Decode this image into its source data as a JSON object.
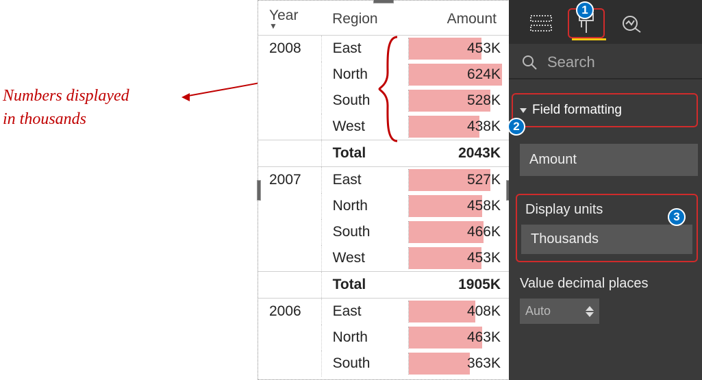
{
  "annotation": {
    "line1": "Numbers displayed",
    "line2": "in thousands"
  },
  "matrix": {
    "headers": {
      "year": "Year",
      "region": "Region",
      "amount": "Amount"
    },
    "groups": [
      {
        "year": "2008",
        "rows": [
          {
            "region": "East",
            "amount": "453K",
            "bar": 74
          },
          {
            "region": "North",
            "amount": "624K",
            "bar": 95
          },
          {
            "region": "South",
            "amount": "528K",
            "bar": 83
          },
          {
            "region": "West",
            "amount": "438K",
            "bar": 72
          }
        ],
        "total_label": "Total",
        "total_amount": "2043K"
      },
      {
        "year": "2007",
        "rows": [
          {
            "region": "East",
            "amount": "527K",
            "bar": 83
          },
          {
            "region": "North",
            "amount": "458K",
            "bar": 75
          },
          {
            "region": "South",
            "amount": "466K",
            "bar": 76
          },
          {
            "region": "West",
            "amount": "453K",
            "bar": 74
          }
        ],
        "total_label": "Total",
        "total_amount": "1905K"
      },
      {
        "year": "2006",
        "rows": [
          {
            "region": "East",
            "amount": "408K",
            "bar": 68
          },
          {
            "region": "North",
            "amount": "463K",
            "bar": 75
          },
          {
            "region": "South",
            "amount": "363K",
            "bar": 62
          }
        ]
      }
    ]
  },
  "panel": {
    "search_placeholder": "Search",
    "section": "Field formatting",
    "field_selected": "Amount",
    "display_units_label": "Display units",
    "display_units_value": "Thousands",
    "decimal_label": "Value decimal places",
    "decimal_value": "Auto",
    "badges": {
      "b1": "1",
      "b2": "2",
      "b3": "3"
    }
  },
  "chart_data": {
    "type": "table",
    "note": "Power BI matrix with pink data bars on Amount column, values shown in thousands (K)",
    "columns": [
      "Year",
      "Region",
      "Amount"
    ],
    "rows": [
      [
        "2008",
        "East",
        "453K"
      ],
      [
        "2008",
        "North",
        "624K"
      ],
      [
        "2008",
        "South",
        "528K"
      ],
      [
        "2008",
        "West",
        "438K"
      ],
      [
        "2008",
        "Total",
        "2043K"
      ],
      [
        "2007",
        "East",
        "527K"
      ],
      [
        "2007",
        "North",
        "458K"
      ],
      [
        "2007",
        "South",
        "466K"
      ],
      [
        "2007",
        "West",
        "453K"
      ],
      [
        "2007",
        "Total",
        "1905K"
      ],
      [
        "2006",
        "East",
        "408K"
      ],
      [
        "2006",
        "North",
        "463K"
      ],
      [
        "2006",
        "South",
        "363K"
      ]
    ]
  }
}
